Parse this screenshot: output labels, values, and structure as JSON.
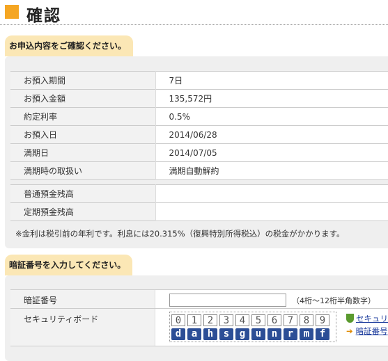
{
  "page": {
    "title": "確認"
  },
  "section1": {
    "heading": "お申込内容をご確認ください。",
    "rows": [
      {
        "label": "お預入期間",
        "value": "7日"
      },
      {
        "label": "お預入金額",
        "value": "135,572円"
      },
      {
        "label": "約定利率",
        "value": "0.5%"
      },
      {
        "label": "お預入日",
        "value": "2014/06/28"
      },
      {
        "label": "満期日",
        "value": "2014/07/05"
      },
      {
        "label": "満期時の取扱い",
        "value": "満期自動解約"
      }
    ],
    "balances": [
      {
        "label": "普通預金残高",
        "value": ""
      },
      {
        "label": "定期預金残高",
        "value": ""
      }
    ],
    "note": "※金利は税引前の年利です。利息には20.315%（復興特別所得税込）の税金がかかります。"
  },
  "section2": {
    "heading": "暗証番号を入力してください。",
    "pin": {
      "label": "暗証番号",
      "value": "",
      "hint": "（4桁〜12桁半角数字）"
    },
    "keyboard": {
      "label": "セキュリティボード",
      "digits": [
        "0",
        "1",
        "2",
        "3",
        "4",
        "5",
        "6",
        "7",
        "8",
        "9"
      ],
      "letters": [
        "d",
        "a",
        "h",
        "s",
        "g",
        "u",
        "n",
        "r",
        "m",
        "f"
      ]
    },
    "links": {
      "security": "セキュリティ",
      "pin_link": "暗証番号"
    }
  },
  "colors": {
    "accent": "#f5a623",
    "tab": "#fbe7b5",
    "key_blue": "#2c4e96",
    "link": "#1a3a9c"
  }
}
